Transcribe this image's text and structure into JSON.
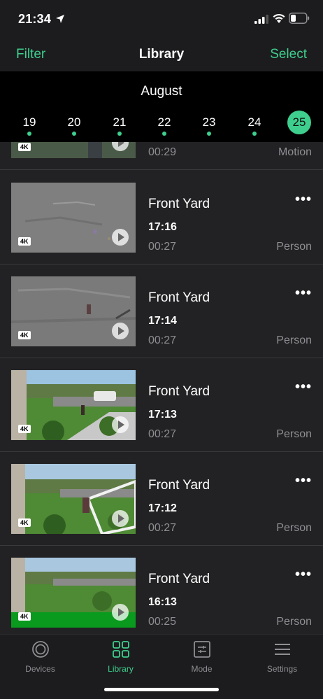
{
  "status_bar": {
    "time": "21:34"
  },
  "navbar": {
    "filter": "Filter",
    "title": "Library",
    "select": "Select"
  },
  "date_strip": {
    "month": "August",
    "days": [
      "19",
      "20",
      "21",
      "22",
      "23",
      "24",
      "25"
    ],
    "active_day": "25"
  },
  "clips": [
    {
      "name": "",
      "time": "",
      "duration": "00:29",
      "tag": "Motion",
      "badge": "4K"
    },
    {
      "name": "Front Yard",
      "time": "17:16",
      "duration": "00:27",
      "tag": "Person",
      "badge": "4K",
      "more": "•••"
    },
    {
      "name": "Front Yard",
      "time": "17:14",
      "duration": "00:27",
      "tag": "Person",
      "badge": "4K",
      "more": "•••"
    },
    {
      "name": "Front Yard",
      "time": "17:13",
      "duration": "00:27",
      "tag": "Person",
      "badge": "4K",
      "more": "•••"
    },
    {
      "name": "Front Yard",
      "time": "17:12",
      "duration": "00:27",
      "tag": "Person",
      "badge": "4K",
      "more": "•••"
    },
    {
      "name": "Front Yard",
      "time": "16:13",
      "duration": "00:25",
      "tag": "Person",
      "badge": "4K",
      "more": "•••"
    }
  ],
  "tabs": [
    {
      "label": "Devices",
      "icon": "devices-icon"
    },
    {
      "label": "Library",
      "icon": "library-grid-icon"
    },
    {
      "label": "Mode",
      "icon": "mode-sliders-icon"
    },
    {
      "label": "Settings",
      "icon": "settings-menu-icon"
    }
  ],
  "colors": {
    "accent": "#3ecf8e",
    "background": "#222224",
    "header": "#1c1c1e",
    "date_strip": "#000000"
  }
}
